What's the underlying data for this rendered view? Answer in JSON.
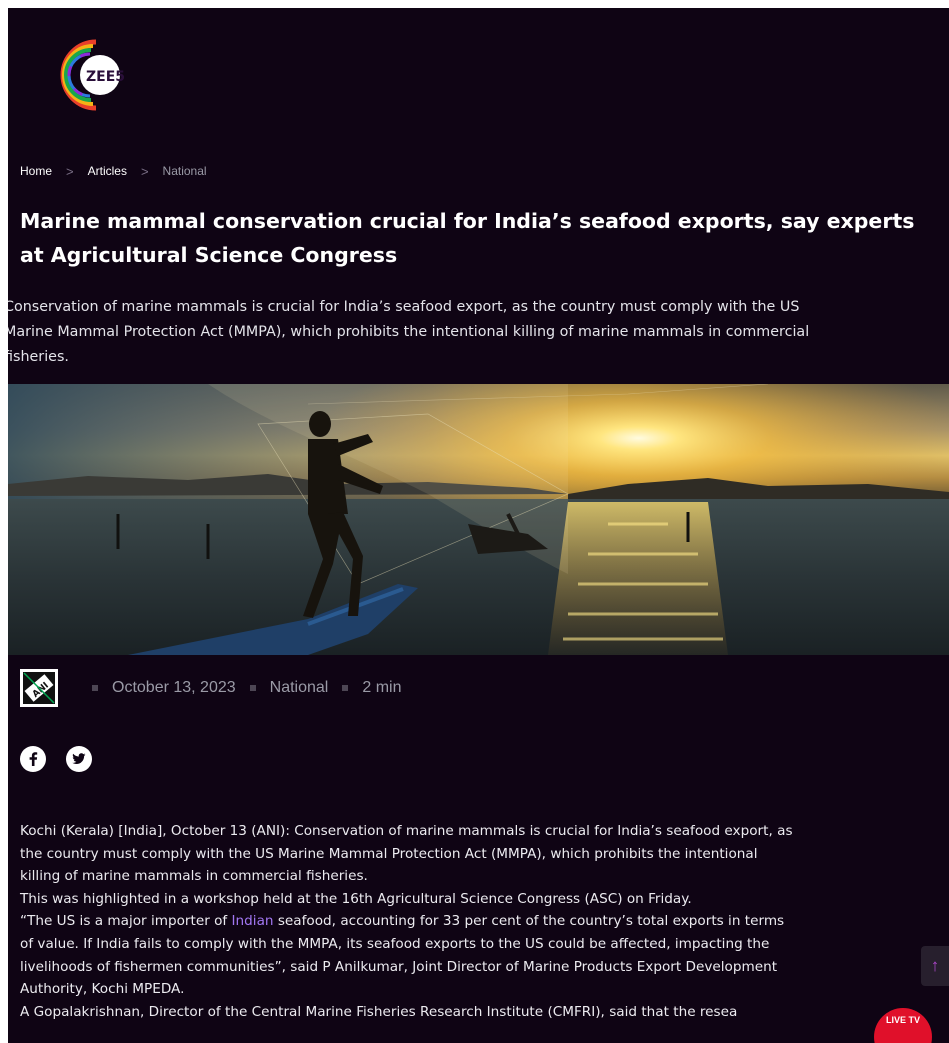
{
  "brand": {
    "logo_text": "ZEE5",
    "colors": {
      "background": "#0f0414",
      "accent": "#a277f3",
      "live_badge": "#e0102a"
    }
  },
  "breadcrumb": [
    {
      "label": "Home",
      "current": false
    },
    {
      "label": "Articles",
      "current": false
    },
    {
      "label": "National",
      "current": true
    }
  ],
  "breadcrumb_separator": ">",
  "article": {
    "headline": "Marine mammal conservation crucial for India’s seafood exports, say experts at Agricultural Science Congress",
    "summary_lines": [
      "Conservation of marine mammals is crucial for India’s seafood export, as the country must comply with the US",
      "Marine Mammal Protection Act (MMPA), which prohibits the intentional killing of marine mammals in commercial",
      "fisheries."
    ],
    "hero_image": "fisherman casting net from boat at sunset",
    "meta": {
      "source_logo": "ANI",
      "date": "October 13, 2023",
      "category": "National",
      "read_time": "2 min"
    },
    "social": [
      "facebook-icon",
      "twitter-icon"
    ],
    "body": {
      "p1_l1": "Kochi (Kerala) [India], October 13 (ANI): Conservation of marine mammals is crucial for India’s seafood export, as",
      "p1_l2": "the country must comply with the US Marine Mammal Protection Act (MMPA), which prohibits the intentional",
      "p1_l3": "killing of marine mammals in commercial fisheries.",
      "p2_l1": "This was highlighted in a workshop held at the 16th Agricultural Science Congress (ASC) on Friday.",
      "p3_l1_pre": "“The US is a major importer of ",
      "p3_l1_link": "Indian",
      "p3_l1_post": " seafood, accounting for 33 per cent of the country’s total exports in terms",
      "p3_l2": "of value. If India fails to comply with the MMPA, its seafood exports to the US could be affected, impacting the",
      "p3_l3": "livelihoods of fishermen communities”, said P Anilkumar, Joint Director of Marine Products Export Development",
      "p3_l4": "Authority, Kochi MPEDA.",
      "p4_l1": "A Gopalakrishnan, Director of the Central Marine Fisheries Research Institute (CMFRI), said that the resea"
    }
  },
  "floating": {
    "scroll_top_icon": "arrow-up-icon",
    "live_tv_label": "LIVE TV"
  }
}
